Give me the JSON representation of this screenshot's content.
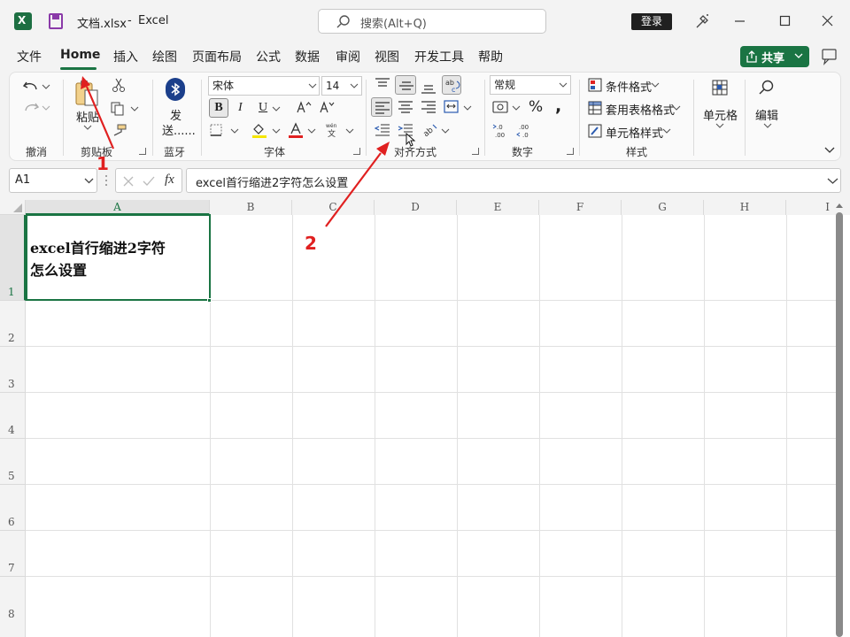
{
  "titlebar": {
    "filename": "文档.xlsx",
    "separator": "-",
    "app": "Excel",
    "search_placeholder": "搜索(Alt+Q)",
    "login": "登录"
  },
  "menu": {
    "items": [
      "文件",
      "Home",
      "插入",
      "绘图",
      "页面布局",
      "公式",
      "数据",
      "审阅",
      "视图",
      "开发工具",
      "帮助"
    ],
    "share": "共享"
  },
  "ribbon": {
    "undo_group": "撤消",
    "clipboard": {
      "paste": "粘贴",
      "label": "剪贴板"
    },
    "bluetooth": {
      "send": "发",
      "send2": "送......",
      "label": "蓝牙"
    },
    "font": {
      "name": "宋体",
      "size": "14",
      "bold": "B",
      "italic": "I",
      "underline": "U",
      "label": "字体"
    },
    "alignment": {
      "label": "对齐方式"
    },
    "number": {
      "format": "常规",
      "label": "数字"
    },
    "styles": {
      "conditional": "条件格式",
      "table": "套用表格格式",
      "cell": "单元格样式",
      "label": "样式"
    },
    "cells": {
      "label": "单元格"
    },
    "editing": {
      "label": "编辑"
    }
  },
  "formula_bar": {
    "name_box": "A1",
    "fx": "fx",
    "content": "excel首行缩进2字符怎么设置"
  },
  "sheet": {
    "columns": [
      "A",
      "B",
      "C",
      "D",
      "E",
      "F",
      "G",
      "H",
      "I"
    ],
    "rows": [
      "1",
      "2",
      "3",
      "4",
      "5",
      "6",
      "7",
      "8"
    ],
    "a1_line1": "excel首行缩进2字符",
    "a1_line2": "怎么设置"
  },
  "annotations": {
    "one": "1",
    "two": "2"
  },
  "colors": {
    "accent": "#1a7443",
    "arrow": "#e02020",
    "font_color": "#e02020",
    "highlight": "#f5e600"
  }
}
